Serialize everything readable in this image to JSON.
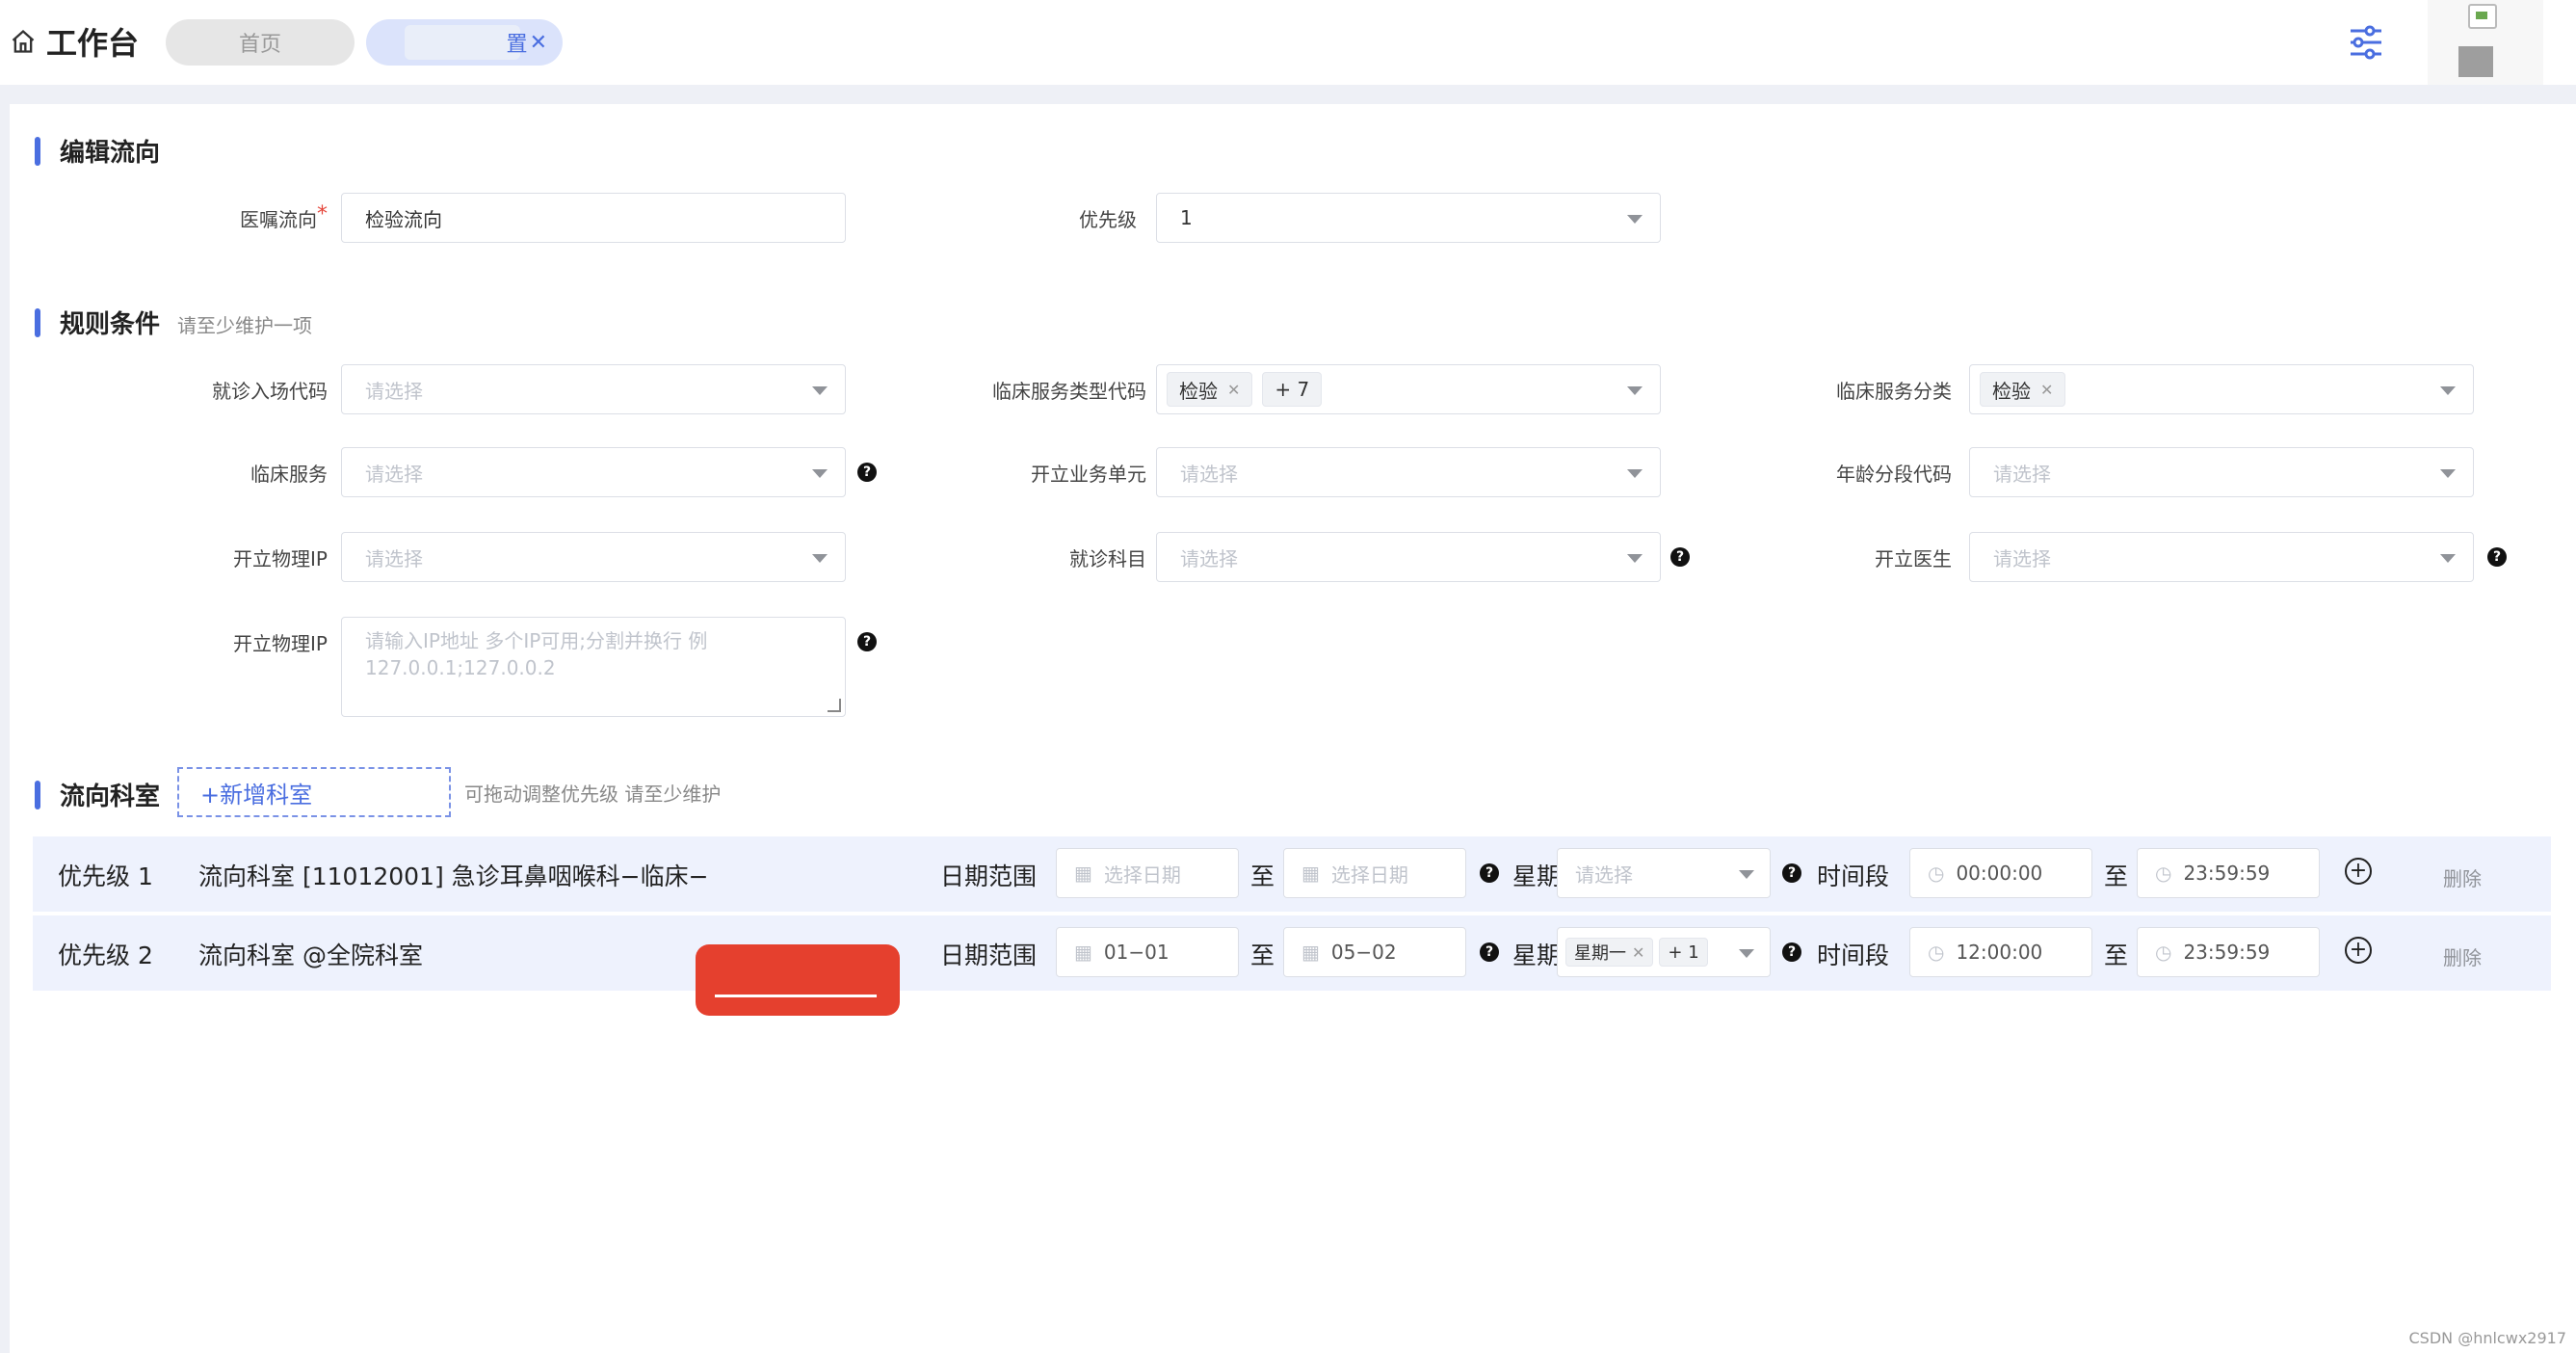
{
  "header": {
    "title": "工作台",
    "tabs": [
      {
        "label": "首页"
      },
      {
        "label": "置"
      }
    ],
    "close_glyph": "✕"
  },
  "edit_section": {
    "title": "编辑流向",
    "fields": {
      "flow_label": "医嘱流向",
      "flow_value": "检验流向",
      "priority_label": "优先级",
      "priority_value": "1"
    }
  },
  "rule_section": {
    "title": "规则条件",
    "hint": "请至少维护一项",
    "placeholder": "请选择",
    "fields": {
      "visit_code": "就诊入场代码",
      "service_type_code": "临床服务类型代码",
      "service_type_chip": "检验",
      "service_type_more": "+ 7",
      "service_class": "临床服务分类",
      "service_class_chip": "检验",
      "clinical_service": "临床服务",
      "business_unit": "开立业务单元",
      "age_code": "年龄分段代码",
      "physical_ip": "开立物理IP",
      "visit_dept": "就诊科目",
      "doctor": "开立医生",
      "ip_textarea_label": "开立物理IP",
      "ip_textarea_placeholder": "请输入IP地址 多个IP可用;分割并换行 例 127.0.0.1;127.0.0.2"
    }
  },
  "dest_section": {
    "title": "流向科室",
    "add_button": "+新增科室",
    "drag_hint": "可拖动调整优先级   请至少维护"
  },
  "rows": [
    {
      "priority": "优先级 1",
      "dest": "流向科室  [11012001] 急诊耳鼻咽喉科−临床−",
      "date_label": "日期范围",
      "date_from": "选择日期",
      "date_to": "选择日期",
      "to": "至",
      "week_label": "星期",
      "week_value": "请选择",
      "time_label": "时间段",
      "time_from": "00:00:00",
      "time_to": "23:59:59",
      "delete": "删除"
    },
    {
      "priority": "优先级 2",
      "dest": "流向科室  @全院科室",
      "date_label": "日期范围",
      "date_from": "01−01",
      "date_to": "05−02",
      "to": "至",
      "week_label": "星期",
      "week_chip": "星期一",
      "week_more": "+ 1",
      "time_label": "时间段",
      "time_from": "12:00:00",
      "time_to": "23:59:59",
      "delete": "删除"
    }
  ],
  "watermark": "CSDN @hnlcwx2917",
  "colors": {
    "accent": "#4a6ee0",
    "row_bg": "#eef2fd",
    "required": "#e5453a",
    "redaction": "#e5402e"
  }
}
